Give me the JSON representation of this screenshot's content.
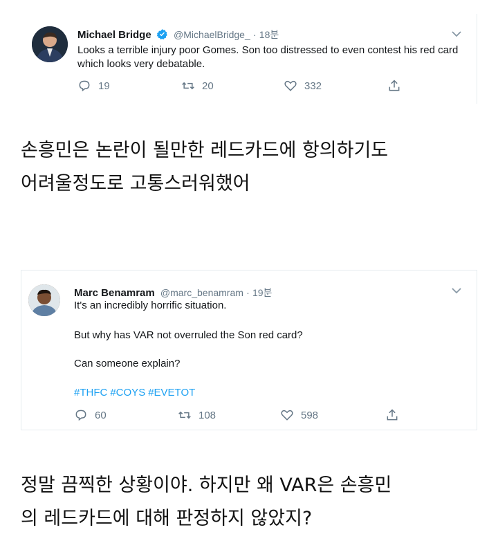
{
  "tweet1": {
    "name": "Michael Bridge",
    "handle": "@MichaelBridge_",
    "separator": "·",
    "time": "18분",
    "text": "Looks a terrible injury poor Gomes. Son too distressed to even contest his red card which looks very debatable.",
    "reply_count": "19",
    "retweet_count": "20",
    "like_count": "332"
  },
  "caption1": {
    "line1": "손흥민은 논란이 될만한 레드카드에 항의하기도",
    "line2": "어려울정도로 고통스러워했어"
  },
  "tweet2": {
    "name": "Marc Benamram",
    "handle": "@marc_benamram",
    "separator": "·",
    "time": "19분",
    "line1": "It's an incredibly horrific situation.",
    "line2": "But why has VAR not overruled the Son red card?",
    "line3": "Can someone explain?",
    "hashtags": [
      "#THFC",
      "#COYS",
      "#EVETOT"
    ],
    "reply_count": "60",
    "retweet_count": "108",
    "like_count": "598"
  },
  "caption2": {
    "line1": "정말 끔찍한 상황이야. 하지만 왜 VAR은 손흥민",
    "line2": "의 레드카드에 대해 판정하지 않았지?"
  },
  "colors": {
    "accent": "#1da1f2",
    "secondary_text": "#657786",
    "primary_text": "#14171a"
  },
  "icons": [
    "verified-icon",
    "chevron-down-icon",
    "reply-icon",
    "retweet-icon",
    "like-icon",
    "share-icon"
  ]
}
